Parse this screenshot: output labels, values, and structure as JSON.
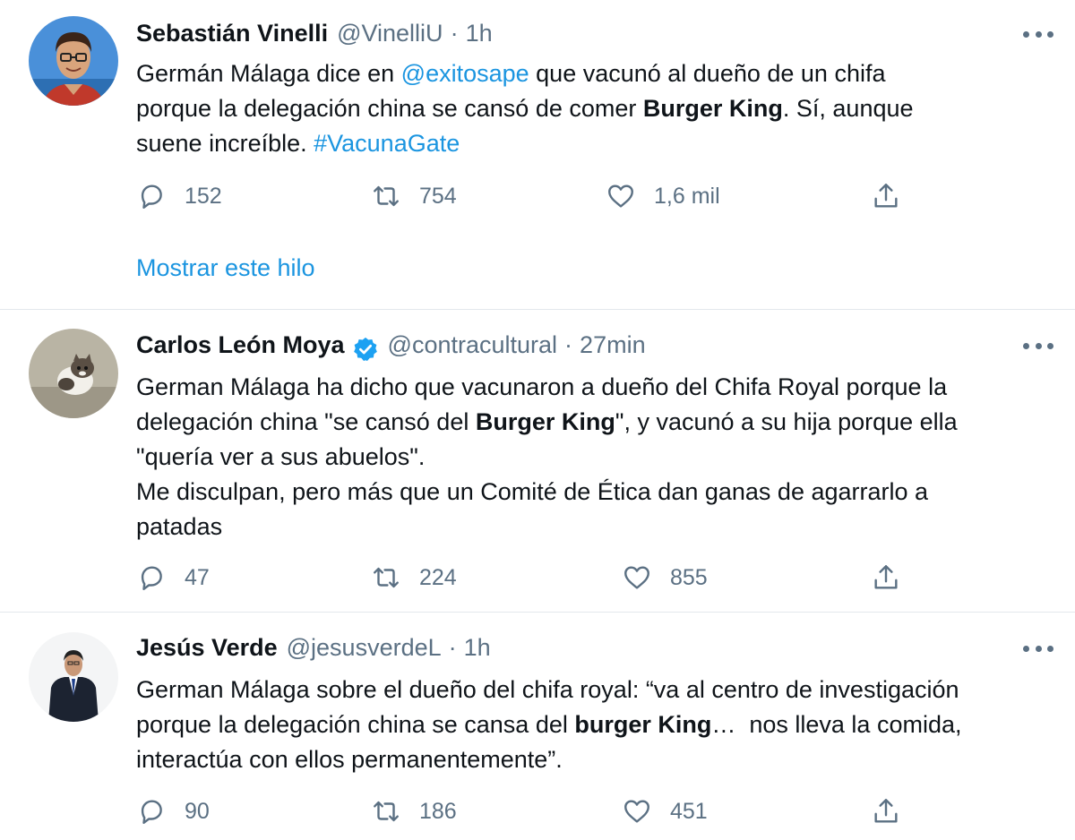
{
  "tweets": [
    {
      "name": "Sebastián Vinelli",
      "handle": "@VinelliU",
      "separator": "·",
      "time": "1h",
      "verified": false,
      "text_parts": [
        "Germán Málaga dice en ",
        "@exitosape",
        " que vacunó al dueño de un chifa\nporque la delegación china se cansó de comer ",
        "Burger King",
        ". Sí, aunque\nsuene increíble. ",
        "#VacunaGate"
      ],
      "replies": "152",
      "retweets": "754",
      "likes": "1,6 mil",
      "show_thread": "Mostrar este hilo"
    },
    {
      "name": "Carlos León Moya",
      "handle": "@contracultural",
      "separator": "·",
      "time": "27min",
      "verified": true,
      "text_parts": [
        "German Málaga ha dicho que vacunaron a dueño del Chifa Royal porque la\ndelegación china \"se cansó del ",
        "Burger King",
        "\", y vacunó a su hija porque ella\n\"quería ver a sus abuelos\".\nMe disculpan, pero más que un Comité de Ética dan ganas de agarrarlo a\npatadas"
      ],
      "replies": "47",
      "retweets": "224",
      "likes": "855"
    },
    {
      "name": "Jesús Verde",
      "handle": "@jesusverdeL",
      "separator": "·",
      "time": "1h",
      "verified": false,
      "text_parts": [
        "German Málaga sobre el dueño del chifa royal: “va al centro de investigación\nporque la delegación china se cansa del ",
        "burger King",
        "…  nos lleva la comida,\ninteractúa con ellos permanentemente”."
      ],
      "replies": "90",
      "retweets": "186",
      "likes": "451"
    }
  ],
  "colors": {
    "link": "#1b95e0",
    "secondary": "#5b7083",
    "text": "#0f1419",
    "divider": "#e3e8ec"
  },
  "icons": {
    "reply": "reply-icon",
    "retweet": "retweet-icon",
    "like": "like-icon",
    "share": "share-icon",
    "more": "more-icon",
    "verified": "verified-badge-icon"
  }
}
